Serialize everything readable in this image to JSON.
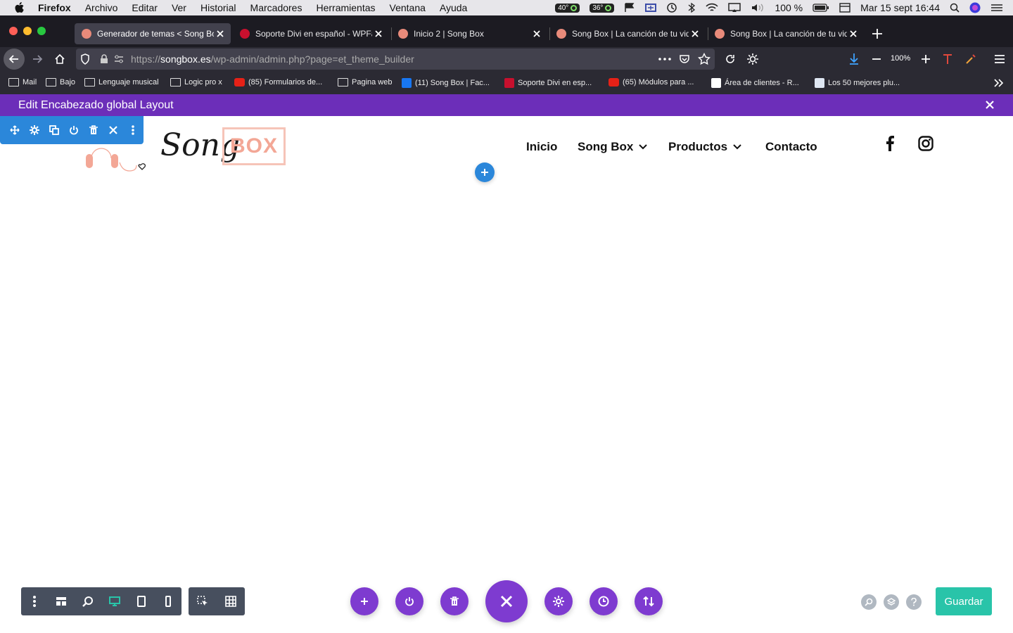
{
  "menubar": {
    "app": "Firefox",
    "items": [
      "Archivo",
      "Editar",
      "Ver",
      "Historial",
      "Marcadores",
      "Herramientas",
      "Ventana",
      "Ayuda"
    ],
    "cpu_temp": "40°",
    "gpu_temp": "36°",
    "battery": "100 %",
    "datetime": "Mar 15 sept  16:44"
  },
  "tabs": [
    {
      "title": "Generador de temas < Song Box",
      "active": true,
      "favicon_color": "#e88a7a"
    },
    {
      "title": "Soporte Divi en español - WPFácil",
      "active": false,
      "favicon_color": "#c8102e"
    },
    {
      "title": "Inicio 2 | Song Box",
      "active": false,
      "favicon_color": "#e88a7a"
    },
    {
      "title": "Song Box | La canción de tu vida",
      "active": false,
      "favicon_color": "#e88a7a"
    },
    {
      "title": "Song Box | La canción de tu vida",
      "active": false,
      "favicon_color": "#e88a7a"
    }
  ],
  "urlbar": {
    "prefix": "https://",
    "host": "songbox.es",
    "path": "/wp-admin/admin.php?page=et_theme_builder"
  },
  "zoom": "100%",
  "bookmarks": [
    {
      "label": "Mail",
      "icon": "folder-icon"
    },
    {
      "label": "Bajo",
      "icon": "folder-icon"
    },
    {
      "label": "Lenguaje musical",
      "icon": "folder-icon"
    },
    {
      "label": "Logic pro x",
      "icon": "folder-icon"
    },
    {
      "label": "(85) Formularios de...",
      "icon": "youtube-icon"
    },
    {
      "label": "Pagina web",
      "icon": "folder-icon"
    },
    {
      "label": "(11) Song Box | Fac...",
      "icon": "facebook-icon"
    },
    {
      "label": "Soporte Divi en esp...",
      "icon": "wpfacil-icon"
    },
    {
      "label": "(65) Módulos para ...",
      "icon": "youtube-icon"
    },
    {
      "label": "Área de clientes - R...",
      "icon": "client-area-icon"
    },
    {
      "label": "Los 50 mejores plu...",
      "icon": "wordpress-icon"
    }
  ],
  "divi": {
    "title": "Edit Encabezado global Layout",
    "save_label": "Guardar",
    "accent": "#7e3bd0",
    "bar_color": "#6c2eb9"
  },
  "site": {
    "logo_script": "Song",
    "logo_box": "BOX",
    "menu": [
      {
        "label": "Inicio",
        "has_dropdown": false
      },
      {
        "label": "Song Box",
        "has_dropdown": true
      },
      {
        "label": "Productos",
        "has_dropdown": true
      },
      {
        "label": "Contacto",
        "has_dropdown": false
      }
    ]
  }
}
